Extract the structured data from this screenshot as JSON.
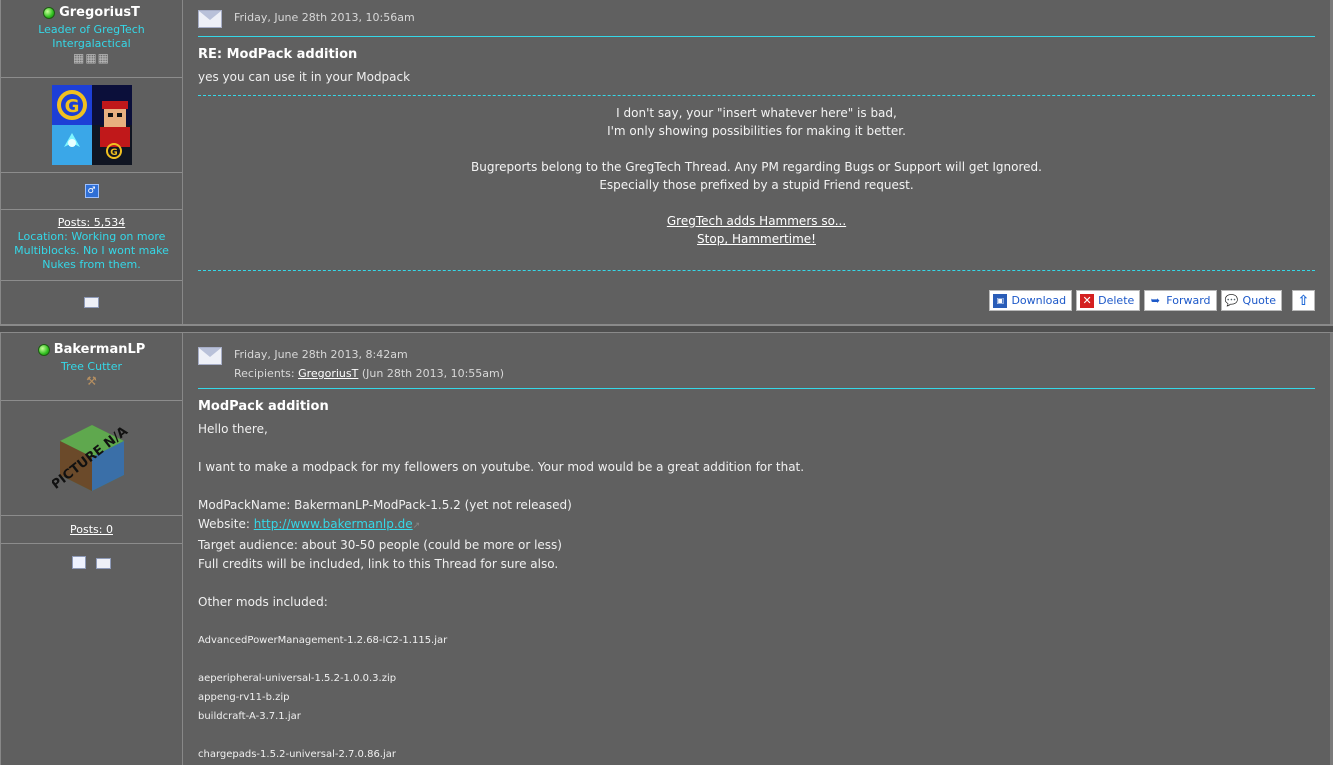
{
  "post1": {
    "author": {
      "name": "GregoriusT",
      "rank_line1": "Leader of GregTech",
      "rank_line2": "Intergalactical",
      "posts": "Posts: 5,534",
      "location_line1": "Location: Working on more",
      "location_line2": "Multiblocks. No I wont make",
      "location_line3": "Nukes from them."
    },
    "date": "Friday, June 28th 2013, 10:56am",
    "subject": "RE: ModPack addition",
    "body": "yes you can use it in your Modpack",
    "signature": {
      "line1": "I don't say, your \"insert whatever here\" is bad,",
      "line2": "I'm only showing possibilities for making it better.",
      "line3": "Bugreports belong to the GregTech Thread. Any PM regarding Bugs or Support will get Ignored.",
      "line4": "Especially those prefixed by a stupid Friend request.",
      "link1": "GregTech adds Hammers so...",
      "link2": "Stop, Hammertime!"
    },
    "actions": {
      "download": "Download",
      "delete": "Delete",
      "forward": "Forward",
      "quote": "Quote"
    }
  },
  "post2": {
    "author": {
      "name": "BakermanLP",
      "rank": "Tree Cutter",
      "posts": "Posts: 0",
      "avatar_text": "PICTURE N/A"
    },
    "date": "Friday, June 28th 2013, 8:42am",
    "recipients_label": "Recipients:",
    "recipient": "GregoriusT",
    "recipient_time": "(Jun 28th 2013, 10:55am)",
    "subject": "ModPack addition",
    "greeting": "Hello there,",
    "intro": "I want to make a modpack for my fellowers on youtube. Your mod would be a great addition for that.",
    "modpack_name": "ModPackName: BakermanLP-ModPack-1.5.2 (yet not released)",
    "website_label": "Website:",
    "website_url": "http://www.bakermanlp.de",
    "audience": "Target audience: about 30-50 people (could be more or less)",
    "credits": "Full credits will be included, link to this Thread for sure also.",
    "other_mods_label": "Other mods included:",
    "mods": [
      "AdvancedPowerManagement-1.2.68-IC2-1.115.jar",
      "aeperipheral-universal-1.5.2-1.0.0.3.zip",
      "appeng-rv11-b.zip",
      "buildcraft-A-3.7.1.jar",
      "chargepads-1.5.2-universal-2.7.0.86.jar"
    ]
  }
}
